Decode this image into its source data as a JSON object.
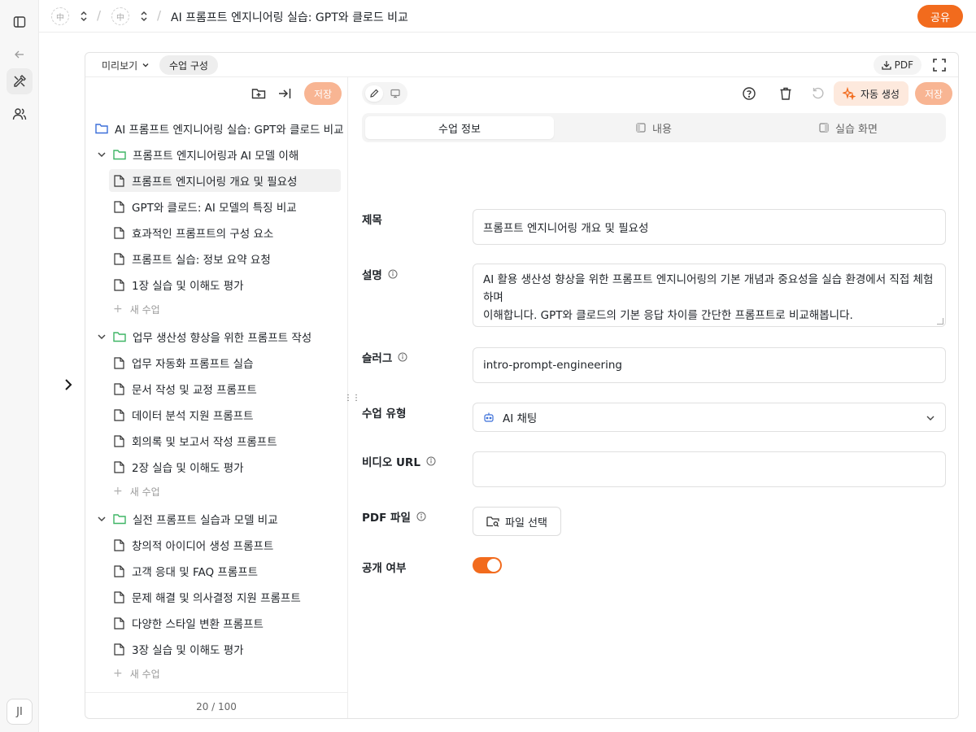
{
  "sidebar": {
    "avatar_initials": "JI"
  },
  "breadcrumb": {
    "title": "AI 프롬프트 엔지니어링 실습: GPT와 클로드 비교",
    "sep1": "/",
    "sep2": "/"
  },
  "header": {
    "share_label": "공유"
  },
  "card_header": {
    "preview_label": "미리보기",
    "structure_label": "수업 구성",
    "pdf_label": "PDF"
  },
  "tree": {
    "save_label": "저장",
    "course_title": "AI 프롬프트 엔지니어링 실습: GPT와 클로드 비교",
    "new_lesson_label": "새 수업",
    "chapters": [
      {
        "title": "프롬프트 엔지니어링과 AI 모델 이해",
        "lessons": [
          "프롬프트 엔지니어링 개요 및 필요성",
          "GPT와 클로드: AI 모델의 특징 비교",
          "효과적인 프롬프트의 구성 요소",
          "프롬프트 실습: 정보 요약 요청",
          "1장 실습 및 이해도 평가"
        ]
      },
      {
        "title": "업무 생산성 향상을 위한 프롬프트 작성",
        "lessons": [
          "업무 자동화 프롬프트 실습",
          "문서 작성 및 교정 프롬프트",
          "데이터 분석 지원 프롬프트",
          "회의록 및 보고서 작성 프롬프트",
          "2장 실습 및 이해도 평가"
        ]
      },
      {
        "title": "실전 프롬프트 실습과 모델 비교",
        "lessons": [
          "창의적 아이디어 생성 프롬프트",
          "고객 응대 및 FAQ 프롬프트",
          "문제 해결 및 의사결정 지원 프롬프트",
          "다양한 스타일 변환 프롬프트",
          "3장 실습 및 이해도 평가"
        ]
      }
    ],
    "count": "20 / 100"
  },
  "form": {
    "autogen_label": "자동 생성",
    "save_label": "저장",
    "tabs": [
      {
        "label": "수업 정보"
      },
      {
        "label": "내용"
      },
      {
        "label": "실습 화면"
      }
    ],
    "title_label": "제목",
    "title_value": "프롬프트 엔지니어링 개요 및 필요성",
    "desc_label": "설명",
    "desc_line1": "AI 활용 생산성 향상을 위한 프롬프트 엔지니어링의 기본 개념과 중요성을 실습 환경에서 직접 체험하며",
    "desc_line2": "이해합니다. GPT와 클로드의 기본 응답 차이를 간단한 프롬프트로 비교해봅니다.",
    "slug_label": "슬러그",
    "slug_value": "intro-prompt-engineering",
    "type_label": "수업 유형",
    "type_value": "AI 채팅",
    "video_label": "비디오 URL",
    "video_value": "",
    "pdf_label": "PDF 파일",
    "file_button_label": "파일 선택",
    "public_label": "공개 여부",
    "public_on": true
  },
  "colors": {
    "accent": "#f26b1d",
    "accent_soft": "#f8b593",
    "folder": "#3fb565",
    "course_folder": "#3b6fd9"
  }
}
